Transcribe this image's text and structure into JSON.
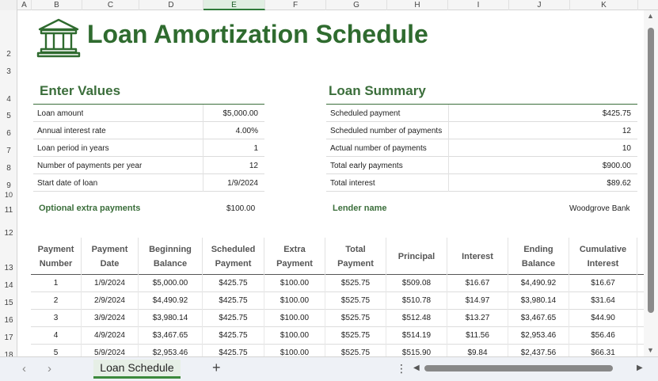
{
  "columns": [
    "A",
    "B",
    "C",
    "D",
    "E",
    "F",
    "G",
    "H",
    "I",
    "J",
    "K"
  ],
  "rows": [
    "2",
    "3",
    "4",
    "5",
    "6",
    "7",
    "8",
    "9",
    "10",
    "11",
    "12",
    "13",
    "14",
    "15",
    "16",
    "17",
    "18"
  ],
  "title": "Loan Amortization Schedule",
  "enter_values": {
    "heading": "Enter Values",
    "items": [
      {
        "label": "Loan amount",
        "value": "$5,000.00"
      },
      {
        "label": "Annual interest rate",
        "value": "4.00%"
      },
      {
        "label": "Loan period in years",
        "value": "1"
      },
      {
        "label": "Number of payments per year",
        "value": "12"
      },
      {
        "label": "Start date of loan",
        "value": "1/9/2024"
      }
    ],
    "extra_label": "Optional extra payments",
    "extra_value": "$100.00"
  },
  "loan_summary": {
    "heading": "Loan Summary",
    "items": [
      {
        "label": "Scheduled payment",
        "value": "$425.75"
      },
      {
        "label": "Scheduled number of payments",
        "value": "12"
      },
      {
        "label": "Actual number of payments",
        "value": "10"
      },
      {
        "label": "Total early payments",
        "value": "$900.00"
      },
      {
        "label": "Total interest",
        "value": "$89.62"
      }
    ],
    "lender_label": "Lender name",
    "lender_value": "Woodgrove Bank"
  },
  "schedule": {
    "headers": [
      [
        "Payment",
        "Number"
      ],
      [
        "Payment",
        "Date"
      ],
      [
        "Beginning",
        "Balance"
      ],
      [
        "Scheduled",
        "Payment"
      ],
      [
        "Extra",
        "Payment"
      ],
      [
        "Total",
        "Payment"
      ],
      [
        "Principal"
      ],
      [
        "Interest"
      ],
      [
        "Ending",
        "Balance"
      ],
      [
        "Cumulative",
        "Interest"
      ]
    ],
    "rows": [
      [
        "1",
        "1/9/2024",
        "$5,000.00",
        "$425.75",
        "$100.00",
        "$525.75",
        "$509.08",
        "$16.67",
        "$4,490.92",
        "$16.67"
      ],
      [
        "2",
        "2/9/2024",
        "$4,490.92",
        "$425.75",
        "$100.00",
        "$525.75",
        "$510.78",
        "$14.97",
        "$3,980.14",
        "$31.64"
      ],
      [
        "3",
        "3/9/2024",
        "$3,980.14",
        "$425.75",
        "$100.00",
        "$525.75",
        "$512.48",
        "$13.27",
        "$3,467.65",
        "$44.90"
      ],
      [
        "4",
        "4/9/2024",
        "$3,467.65",
        "$425.75",
        "$100.00",
        "$525.75",
        "$514.19",
        "$11.56",
        "$2,953.46",
        "$56.46"
      ],
      [
        "5",
        "5/9/2024",
        "$2,953.46",
        "$425.75",
        "$100.00",
        "$525.75",
        "$515.90",
        "$9.84",
        "$2,437.56",
        "$66.31"
      ]
    ]
  },
  "tabs": {
    "active_sheet": "Loan Schedule",
    "add_symbol": "+",
    "prev_symbol": "‹",
    "next_symbol": "›",
    "menu_symbol": "⋮"
  },
  "colors": {
    "accent": "#2f6b2f",
    "tab_underline": "#3c8a3c"
  }
}
